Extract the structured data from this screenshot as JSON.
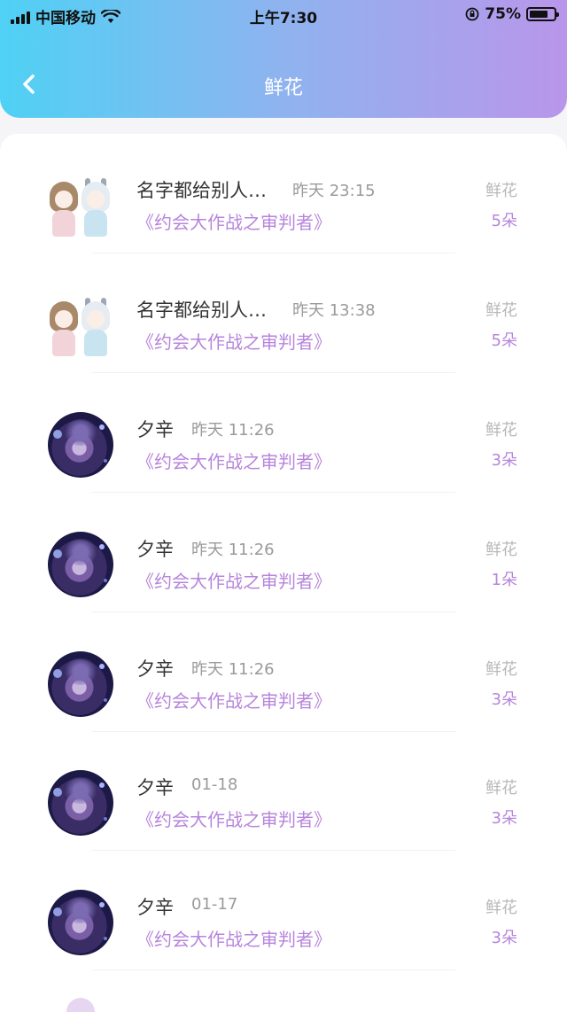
{
  "status_bar": {
    "carrier": "中国移动",
    "time": "上午7:30",
    "battery_percent": "75%",
    "battery_level": 0.75
  },
  "nav": {
    "title": "鲜花",
    "back_icon": "chevron-left-icon"
  },
  "records": [
    {
      "avatar": "anime-pair-avatar",
      "name": "名字都给别人…",
      "time": "昨天 23:15",
      "work": "《约会大作战之审判者》",
      "gift_label": "鲜花",
      "gift_count": "5朵"
    },
    {
      "avatar": "anime-pair-avatar",
      "name": "名字都给别人…",
      "time": "昨天 13:38",
      "work": "《约会大作战之审判者》",
      "gift_label": "鲜花",
      "gift_count": "5朵"
    },
    {
      "avatar": "anime-girl-avatar",
      "name": "夕辛",
      "time": "昨天 11:26",
      "work": "《约会大作战之审判者》",
      "gift_label": "鲜花",
      "gift_count": "3朵"
    },
    {
      "avatar": "anime-girl-avatar",
      "name": "夕辛",
      "time": "昨天 11:26",
      "work": "《约会大作战之审判者》",
      "gift_label": "鲜花",
      "gift_count": "1朵"
    },
    {
      "avatar": "anime-girl-avatar",
      "name": "夕辛",
      "time": "昨天 11:26",
      "work": "《约会大作战之审判者》",
      "gift_label": "鲜花",
      "gift_count": "3朵"
    },
    {
      "avatar": "anime-girl-avatar",
      "name": "夕辛",
      "time": "01-18",
      "work": "《约会大作战之审判者》",
      "gift_label": "鲜花",
      "gift_count": "3朵"
    },
    {
      "avatar": "anime-girl-avatar",
      "name": "夕辛",
      "time": "01-17",
      "work": "《约会大作战之审判者》",
      "gift_label": "鲜花",
      "gift_count": "3朵"
    }
  ],
  "colors": {
    "header_gradient_start": "#4fd1f5",
    "header_gradient_end": "#b996ea",
    "accent_purple": "#b785dc",
    "muted_gray": "#b8b8b8"
  }
}
